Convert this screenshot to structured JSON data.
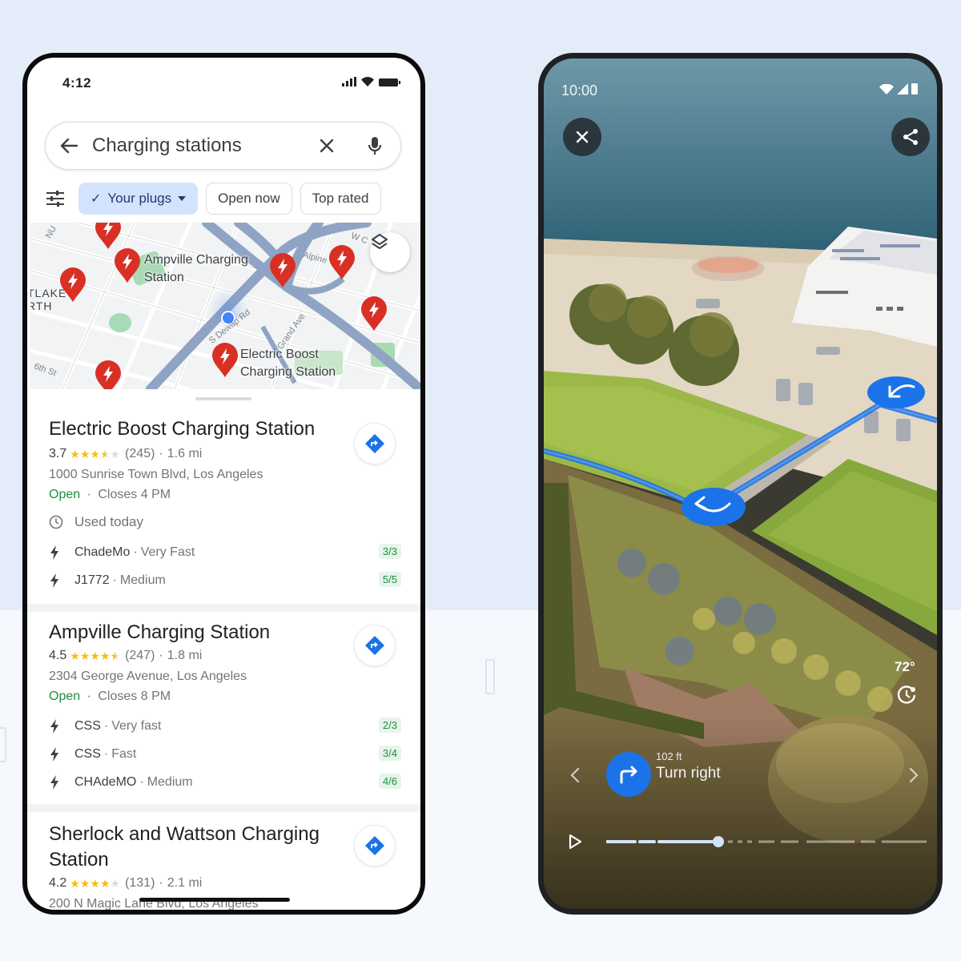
{
  "left_phone": {
    "status": {
      "time": "4:12"
    },
    "search": {
      "query": "Charging stations"
    },
    "filters": [
      {
        "label": "Your plugs",
        "active": true,
        "has_check": true,
        "has_dropdown": true
      },
      {
        "label": "Open now",
        "active": false
      },
      {
        "label": "Top rated",
        "active": false
      }
    ],
    "map": {
      "labels": {
        "ampville": "Ampville Charging\nStation",
        "ampville_l1": "Ampville Charging",
        "ampville_l2": "Station",
        "electric_l1": "Electric Boost",
        "electric_l2": "Charging Station",
        "district_l1": "TLAKE",
        "district_l2": "RTH",
        "street_dewap": "S Dewap Rd",
        "street_grand": "Grand Ave",
        "street_alpine": "Alpine",
        "street_6th": "6th St",
        "street_wc": "W C",
        "street_nu": "NU"
      }
    },
    "results": [
      {
        "name": "Electric Boost Charging Station",
        "rating": "3.7",
        "rating_value": 3.7,
        "reviews": "(245)",
        "distance": "1.6 mi",
        "address": "1000 Sunrise Town Blvd, Los Angeles",
        "open_label": "Open",
        "closes": "Closes 4 PM",
        "used": "Used today",
        "plugs": [
          {
            "type": "ChadeMo",
            "speed": "Very Fast",
            "availability": "3/3"
          },
          {
            "type": "J1772",
            "speed": "Medium",
            "availability": "5/5"
          }
        ]
      },
      {
        "name": "Ampville Charging Station",
        "rating": "4.5",
        "rating_value": 4.5,
        "reviews": "(247)",
        "distance": "1.8 mi",
        "address": "2304 George Avenue, Los Angeles",
        "open_label": "Open",
        "closes": "Closes 8 PM",
        "plugs": [
          {
            "type": "CSS",
            "speed": "Very fast",
            "availability": "2/3"
          },
          {
            "type": "CSS",
            "speed": "Fast",
            "availability": "3/4"
          },
          {
            "type": "CHAdeMO",
            "speed": "Medium",
            "availability": "4/6"
          }
        ]
      },
      {
        "name_line1": "Sherlock and Wattson Charging",
        "name_line2": "Station",
        "rating": "4.2",
        "rating_value": 4.2,
        "reviews": "(131)",
        "distance": "2.1 mi",
        "address": "200 N Magic Lane Blvd, Los Angeles"
      }
    ],
    "separator": "·"
  },
  "right_phone": {
    "status": {
      "time": "10:00"
    },
    "weather": {
      "temperature": "72°"
    },
    "instruction": {
      "distance": "102 ft",
      "text": "Turn right"
    },
    "timeline": {
      "progress": 0.35
    }
  },
  "colors": {
    "accent_blue": "#1a73e8",
    "pin_red": "#d93025",
    "open_green": "#1e8e3e",
    "star_yellow": "#fbbc04",
    "chip_active_bg": "#d3e3fd",
    "background": "#e4ecfa"
  }
}
